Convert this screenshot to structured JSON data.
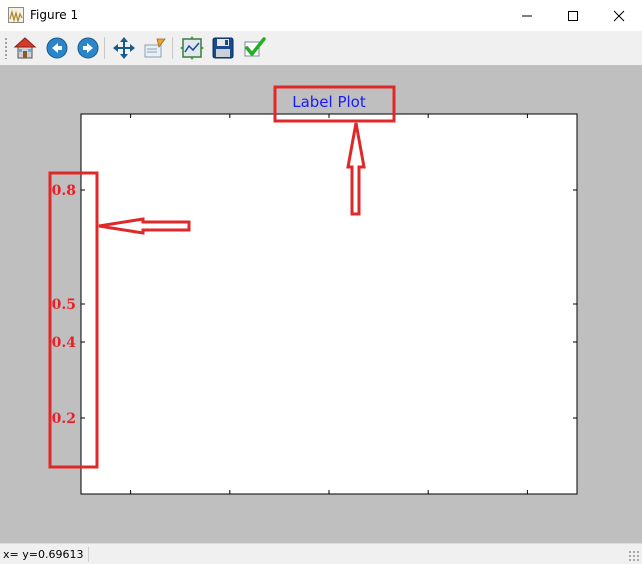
{
  "window": {
    "title": "Figure 1"
  },
  "toolbar": {
    "buttons": [
      {
        "name": "home-button",
        "icon": "home-icon",
        "tooltip": "Home"
      },
      {
        "name": "back-button",
        "icon": "back-arrow-icon",
        "tooltip": "Back"
      },
      {
        "name": "forward-button",
        "icon": "forward-arrow-icon",
        "tooltip": "Forward"
      },
      {
        "name": "pan-button",
        "icon": "pan-arrows-icon",
        "tooltip": "Pan"
      },
      {
        "name": "zoom-button",
        "icon": "zoom-rect-icon",
        "tooltip": "Zoom"
      },
      {
        "name": "subplots-button",
        "icon": "subplots-icon",
        "tooltip": "Configure subplots"
      },
      {
        "name": "save-button",
        "icon": "floppy-disk-icon",
        "tooltip": "Save"
      },
      {
        "name": "edit-button",
        "icon": "checkmark-icon",
        "tooltip": "Edit parameters"
      }
    ]
  },
  "chart_data": {
    "type": "scatter",
    "title": "Label Plot",
    "title_color": "#1a1aff",
    "xlabel": "",
    "ylabel": "",
    "ylim": [
      0.0,
      1.0
    ],
    "yticks": [
      0.2,
      0.4,
      0.5,
      0.8
    ],
    "ytick_labels": [
      "0.2",
      "0.4",
      "0.5",
      "0.8"
    ],
    "ytick_color": "#e8202a",
    "xticks_count": 5,
    "xtick_labels": [],
    "grid": false,
    "series": []
  },
  "annotations": {
    "color": "#e02828"
  },
  "status": {
    "text": "x= y=0.69613"
  }
}
